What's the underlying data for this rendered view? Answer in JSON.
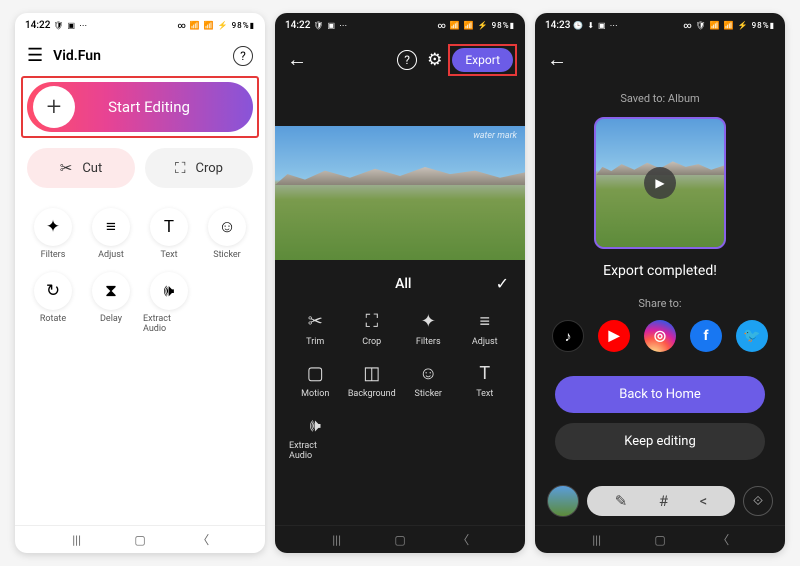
{
  "screen1": {
    "status": {
      "time": "14:22",
      "icons_left": "🛡 ▣ ⋯",
      "icons_right": "∞ 📶 📶 ⚡ 98%▮"
    },
    "app_title": "Vid.Fun",
    "start_editing": "Start Editing",
    "cut": "Cut",
    "crop": "Crop",
    "tools": [
      {
        "icon": "✦",
        "label": "Filters"
      },
      {
        "icon": "≡",
        "label": "Adjust"
      },
      {
        "icon": "T",
        "label": "Text"
      },
      {
        "icon": "☺",
        "label": "Sticker"
      },
      {
        "icon": "↻",
        "label": "Rotate"
      },
      {
        "icon": "⧗",
        "label": "Delay"
      },
      {
        "icon": "🕪",
        "label": "Extract Audio"
      }
    ]
  },
  "screen2": {
    "status": {
      "time": "14:22",
      "icons_left": "🛡 ▣ ⋯",
      "icons_right": "∞ 📶 📶 ⚡ 98%▮"
    },
    "export": "Export",
    "watermark": "water mark",
    "tab_all": "All",
    "tools": [
      {
        "icon": "✂",
        "label": "Trim"
      },
      {
        "icon": "⛶",
        "label": "Crop"
      },
      {
        "icon": "✦",
        "label": "Filters"
      },
      {
        "icon": "≡",
        "label": "Adjust"
      },
      {
        "icon": "▢",
        "label": "Motion"
      },
      {
        "icon": "◫",
        "label": "Background"
      },
      {
        "icon": "☺",
        "label": "Sticker"
      },
      {
        "icon": "T",
        "label": "Text"
      },
      {
        "icon": "🕪",
        "label": "Extract Audio"
      }
    ]
  },
  "screen3": {
    "status": {
      "time": "14:23",
      "icons_left": "🕒 ⬇ ▣ ⋯",
      "icons_right": "∞ 🛡 📶 📶 ⚡ 98%▮"
    },
    "saved_to": "Saved to: Album",
    "export_completed": "Export completed!",
    "share_to": "Share to:",
    "back_home": "Back to Home",
    "keep_editing": "Keep editing",
    "share": [
      {
        "name": "tiktok",
        "glyph": "♪"
      },
      {
        "name": "youtube",
        "glyph": "▶"
      },
      {
        "name": "instagram",
        "glyph": "◎"
      },
      {
        "name": "facebook",
        "glyph": "f"
      },
      {
        "name": "twitter",
        "glyph": "🐦"
      }
    ]
  }
}
